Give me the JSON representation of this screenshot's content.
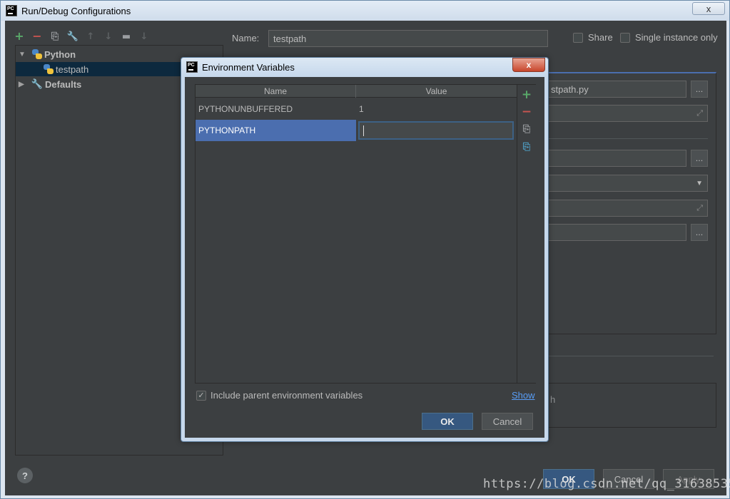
{
  "window": {
    "title": "Run/Debug Configurations",
    "close_label": "x"
  },
  "toolbar": {
    "add": "+",
    "remove": "−",
    "copy": "⎘",
    "edit_defaults": "🔧",
    "move_up": "↑",
    "move_down": "↓",
    "folder": "▬",
    "sort": "↓"
  },
  "tree": {
    "python_label": "Python",
    "testpath_label": "testpath",
    "defaults_label": "Defaults"
  },
  "form": {
    "name_label": "Name:",
    "name_value": "testpath",
    "share_label": "Share",
    "single_instance_label": "Single instance only",
    "script_value": "stpath.py",
    "dots": "...",
    "peek_text": "h"
  },
  "buttons": {
    "ok": "OK",
    "cancel": "Cancel",
    "apply": "Apply",
    "help": "?"
  },
  "dialog": {
    "title": "Environment Variables",
    "close_label": "x",
    "columns": [
      "Name",
      "Value"
    ],
    "rows": [
      {
        "name": "PYTHONUNBUFFERED",
        "value": "1"
      },
      {
        "name": "PYTHONPATH",
        "value": ""
      }
    ],
    "include_parent_label": "Include parent environment variables",
    "include_parent_checked": true,
    "show_link": "Show",
    "ok": "OK",
    "cancel": "Cancel"
  },
  "watermark": "https://blog.csdn.net/qq_31638535",
  "colors": {
    "background": "#3c3f41",
    "selection": "#4b6eaf",
    "ok_button": "#365880",
    "add_green": "#59a869",
    "remove_red": "#c75450",
    "link_blue": "#589df6"
  },
  "icons": {
    "python": "python-icon",
    "defaults": "wrench-icon"
  }
}
